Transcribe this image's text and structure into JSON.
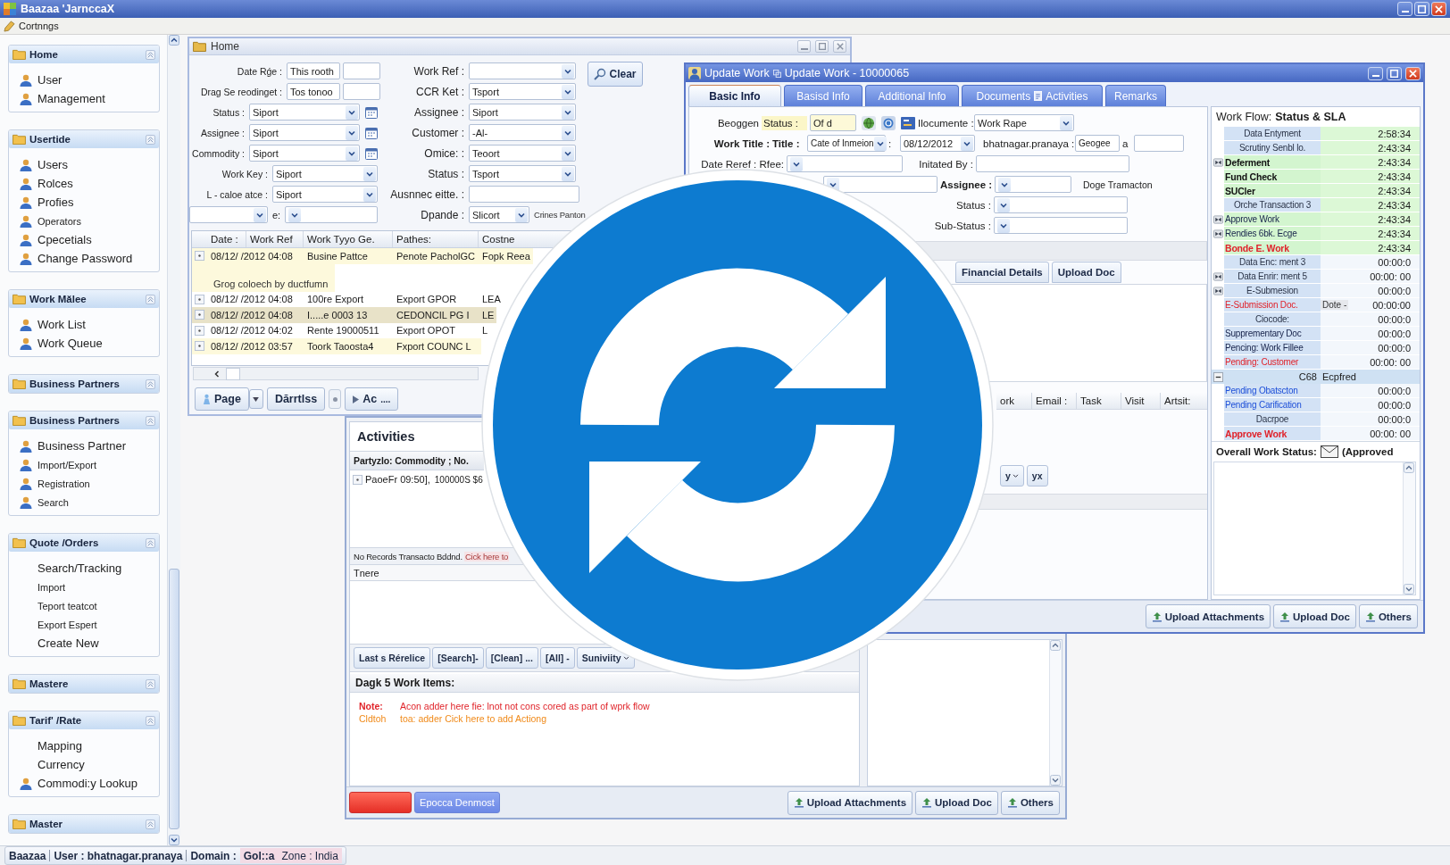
{
  "app_window": {
    "title": "Baazaa 'JarnccaX"
  },
  "menu_bar": {
    "items": [
      "Cortnngs"
    ]
  },
  "sidebar": {
    "groups": [
      {
        "title": "Home",
        "items": [
          {
            "label": "User",
            "icon": true,
            "small": false
          },
          {
            "label": "Management",
            "icon": true,
            "small": false
          }
        ]
      },
      {
        "title": "Usertide",
        "items": [
          {
            "label": "Users",
            "icon": true,
            "small": false
          },
          {
            "label": "Rolces",
            "icon": true,
            "small": false
          },
          {
            "label": "Profies",
            "icon": true,
            "small": false
          },
          {
            "label": "Operators",
            "icon": true,
            "small": true
          },
          {
            "label": "Cpecetials",
            "icon": true,
            "small": false
          },
          {
            "label": "Change Password",
            "icon": true,
            "small": false
          }
        ]
      },
      {
        "title": "Work Mălee",
        "items": [
          {
            "label": "Work List",
            "icon": true,
            "small": false
          },
          {
            "label": "Work Queue",
            "icon": true,
            "small": false
          }
        ]
      },
      {
        "title": "Business Partners"
      },
      {
        "title": "Business Partners",
        "items": [
          {
            "label": "Business Partner",
            "icon": true,
            "small": false
          },
          {
            "label": "Import/Export",
            "icon": true,
            "small": true
          },
          {
            "label": "Registration",
            "icon": true,
            "small": true
          },
          {
            "label": "Search",
            "icon": true,
            "small": true
          }
        ]
      },
      {
        "title": "Quote /Orders",
        "items": [
          {
            "label": "Search/Tracking",
            "icon": false,
            "small": false
          },
          {
            "label": "Import",
            "icon": false,
            "small": true
          },
          {
            "label": "Teport teatcot",
            "icon": false,
            "small": true
          },
          {
            "label": "Export Espert",
            "icon": false,
            "small": true
          },
          {
            "label": "Create New",
            "icon": false,
            "small": false
          }
        ]
      },
      {
        "title": "Mastere"
      },
      {
        "title": "Tarif' /Rate",
        "items": [
          {
            "label": "Mapping",
            "icon": false,
            "small": false
          },
          {
            "label": "Currency",
            "icon": false,
            "small": false
          },
          {
            "label": "Commodi:y Lookup",
            "icon": true,
            "small": false
          }
        ]
      },
      {
        "title": "Master"
      }
    ]
  },
  "home_window": {
    "title": "Home",
    "filters_left": [
      {
        "kind": "range",
        "label": "Date Rǵe :",
        "value": "This rooth"
      },
      {
        "kind": "range",
        "label": "Drag Se reodinget :",
        "value": "Tos tonoo"
      },
      {
        "kind": "picker",
        "label": "Status :",
        "value": "Siport"
      },
      {
        "kind": "picker",
        "label": "Assignee :",
        "value": "Siport"
      },
      {
        "kind": "picker",
        "label": "Commodity :",
        "value": "Siport"
      },
      {
        "kind": "dropdown",
        "label": "Work Key :",
        "value": "Siport"
      },
      {
        "kind": "dropdown",
        "label": "L - caloe atce :",
        "value": "Siport"
      },
      {
        "kind": "pair",
        "label": "e:"
      }
    ],
    "filters_right": [
      {
        "kind": "dropdown",
        "label": "Work Ref :"
      },
      {
        "kind": "dropdown",
        "label": "CCR Ket :",
        "value": "Tsport"
      },
      {
        "kind": "dropdown",
        "label": "Assignee :",
        "value": "Siport"
      },
      {
        "kind": "dropdown",
        "label": "Customer :",
        "value": "-Al-"
      },
      {
        "kind": "dropdown",
        "label": "Omice: :",
        "value": "Teoort"
      },
      {
        "kind": "dropdown",
        "label": "Status :",
        "value": "Tsport"
      },
      {
        "kind": "text",
        "label": "Ausnnec eitte. :"
      },
      {
        "kind": "short",
        "label": "Dpande :",
        "value": "Slicort",
        "note": "Crines Panton"
      }
    ],
    "clear_button": "Clear",
    "grid": {
      "columns": [
        "Date :",
        "Work Ref",
        "Work Tyyo Ge.",
        "Pathes:",
        "Costne"
      ],
      "rows": [
        {
          "kind": "row",
          "cells": [
            "08/12/ /2012 04:08",
            "Busine Pattce",
            "Penote PacholGC",
            "Fopk Reea"
          ],
          "flagged": true,
          "selected": false
        },
        {
          "kind": "group",
          "label": "Grog coloech by ductfumn",
          "flagged": true,
          "selected": false
        },
        {
          "kind": "row",
          "cells": [
            "08/12/ /2012 04:08",
            "100re Export",
            "Export GPOR",
            "LEA"
          ],
          "flagged": false,
          "selected": false
        },
        {
          "kind": "row",
          "cells": [
            "08/12/ /2012 04:08",
            "I.....e 0003 13",
            "CEDONCIL PG I",
            "LE"
          ],
          "flagged": false,
          "selected": true
        },
        {
          "kind": "row",
          "cells": [
            "08/12/ /2012 04:02",
            "Rente 19000511",
            "Export OPOT",
            "L"
          ],
          "flagged": false,
          "selected": false
        },
        {
          "kind": "row",
          "cells": [
            "08/12/ /2012 03:57",
            "Toork Taoosta4",
            "Fxport COUNC L"
          ],
          "flagged": true,
          "selected": false
        }
      ]
    },
    "pager": {
      "page_button": "Page",
      "second_button": "Dărrtlss",
      "next_button": "Ac",
      "more": "...."
    }
  },
  "update_window": {
    "breadcrumb": "Update Work",
    "title": "Update Work - 10000065",
    "tabs": [
      {
        "label": "Basic Info",
        "selected": true
      },
      {
        "label": "Basisd Info",
        "selected": false
      },
      {
        "label": "Additional Info",
        "selected": false
      },
      {
        "label": "Documents",
        "extra": "Activities",
        "selected": false
      },
      {
        "label": "Remarks",
        "selected": false
      }
    ],
    "form": {
      "prefix": "Beoggen",
      "status_label": "Status :",
      "status_value": "Of d",
      "document_label": "Ilocumente :",
      "document_value": "Work Rape",
      "work_title_label": "Work Title :",
      "title_label": "Title :",
      "title_value": "Cate of Inmeion",
      "separator": ":",
      "date_value": "08/12/2012",
      "user_label": "bhatnagar.pranaya :",
      "user_value": "Geogee",
      "extra_label": "a",
      "date_ref_label": "Date Reref : Rfee:",
      "initiated_label": "Initated By :",
      "assignee_label": "Assignee :",
      "assignee_note": "Doge Tramacton",
      "status_2_label": "Status :",
      "sub_status_label": "Sub-Status :"
    },
    "section_buttons": [
      "Financial Details",
      "Upload Doc"
    ],
    "contacts_grid": {
      "columns": [
        "ork",
        "Email :",
        "Task",
        "Visit",
        "Artsit:"
      ]
    },
    "grid_buttons": [
      {
        "kind": "menu",
        "label": "y"
      },
      {
        "kind": "plain",
        "label": "yx"
      }
    ],
    "workflow": {
      "title": "Work Flow: **Status & SLA**",
      "rows": [
        {
          "kind": "centered",
          "label": "Data Entyment",
          "time": "2:58:34",
          "done": true,
          "highlight": false,
          "marker": false
        },
        {
          "kind": "centered",
          "label": "Scrutiny Senbl lo.",
          "time": "2:43:34",
          "done": true,
          "highlight": false,
          "marker": false
        },
        {
          "kind": "bold",
          "label": "Deferment",
          "time": "2:43:34",
          "done": true,
          "highlight": true,
          "marker": true
        },
        {
          "kind": "bold",
          "label": "Fund Check",
          "time": "2:43:34",
          "done": true,
          "highlight": true,
          "marker": false
        },
        {
          "kind": "bold",
          "label": "SUCler",
          "time": "2:43:34",
          "done": true,
          "highlight": true,
          "marker": false
        },
        {
          "kind": "centered",
          "label": "Orche Transaction 3",
          "time": "2:43:34",
          "done": true,
          "highlight": false,
          "marker": false
        },
        {
          "kind": "plain",
          "label": "Approve Work",
          "time": "2:43:34",
          "done": true,
          "highlight": true,
          "marker": true
        },
        {
          "kind": "plain",
          "label": "Rendies 6bk. Ecge",
          "time": "2:43:34",
          "done": true,
          "highlight": true,
          "marker": true
        },
        {
          "kind": "alert_bold",
          "label": "Bonde E. Work",
          "time": "2:43:34",
          "done": true,
          "highlight": true,
          "marker": false
        },
        {
          "kind": "centered",
          "label": "Data Enc: ment 3",
          "time": "00:00:0",
          "done": false,
          "highlight": false,
          "marker": false
        },
        {
          "kind": "centered",
          "label": "Data Enrir: ment 5",
          "time": "00:00: 00",
          "done": false,
          "highlight": false,
          "marker": true
        },
        {
          "kind": "centered",
          "label": "E-Submesion",
          "time": "00:00:0",
          "done": false,
          "highlight": false,
          "marker": true
        },
        {
          "kind": "alert",
          "label": "E-Submission Doc.",
          "tag": "Dote -",
          "time": "00:00:00",
          "done": false,
          "highlight": false,
          "marker": false
        },
        {
          "kind": "centered",
          "label": "Ciocode:",
          "time": "00:00:0",
          "done": false,
          "highlight": false,
          "marker": false
        },
        {
          "kind": "plain",
          "label": "Supprementary Doc",
          "time": "00:00:0",
          "done": false,
          "highlight": false,
          "marker": false
        },
        {
          "kind": "plain",
          "label": "Pencing: Work Fillee",
          "time": "00:00:0",
          "done": false,
          "highlight": false,
          "marker": false
        },
        {
          "kind": "alert",
          "label": "Pending: Customer",
          "time": "00:00: 00",
          "done": false,
          "highlight": false,
          "marker": false
        },
        {
          "kind": "group",
          "label": "C68",
          "value": "Ecpfred"
        },
        {
          "kind": "link",
          "label": "Pending Obatscton",
          "time": "00:00:0",
          "done": false,
          "highlight": false,
          "marker": false
        },
        {
          "kind": "link",
          "label": "Pending Carification",
          "time": "00:00:0",
          "done": false,
          "highlight": false,
          "marker": false
        },
        {
          "kind": "centered",
          "label": "Dacrpoe",
          "time": "00:00:0",
          "done": false,
          "highlight": false,
          "marker": false
        },
        {
          "kind": "alert_bold",
          "label": "Approve Work",
          "time": "00:00: 00",
          "done": false,
          "highlight": false,
          "marker": false
        }
      ],
      "overall_label": "Overall Work Status:",
      "overall_value": "(Approved"
    },
    "footer_buttons": [
      "Upload Attachments",
      "Upload Doc",
      "Others"
    ]
  },
  "activities_window": {
    "title": "Activities",
    "grid_header": "Partyzlo: Commodity ; No.",
    "rows": [
      {
        "cells": [
          "PaoeFr 09:50],",
          "100000S $6"
        ]
      }
    ],
    "records_text": "No Records Transacto Bddnd.",
    "records_link": "Cick here to",
    "section_header": "Tnere",
    "buttons": [
      {
        "kind": "plain",
        "label": "Last s Rérelice"
      },
      {
        "kind": "plain",
        "label": "[Search]-"
      },
      {
        "kind": "plain",
        "label": "[Clean] ..."
      },
      {
        "kind": "plain",
        "label": "[All] -"
      },
      {
        "kind": "menu",
        "label": "Suniviity"
      }
    ],
    "items_header": "Dagk 5 Work Items:",
    "notes": [
      {
        "kind": "note",
        "label": "Note:",
        "text": "Acon adder here fie: lnot not cons cored as part of wprk flow"
      },
      {
        "kind": "hint",
        "label": "Cldtoh",
        "text": "toa: adder Cick here to add Actiong"
      }
    ],
    "footer_left": [
      {
        "kind": "danger"
      },
      {
        "kind": "primary",
        "label": "Epocca Denmost"
      }
    ],
    "footer_buttons": [
      "Upload Attachments",
      "Upload Doc",
      "Others"
    ]
  },
  "status_bar": {
    "app": "Baazaa",
    "user": "User : bhatnagar.pranaya",
    "domain_label": "Domain :",
    "domain": "Gol::a",
    "zone": "Zone : India"
  }
}
